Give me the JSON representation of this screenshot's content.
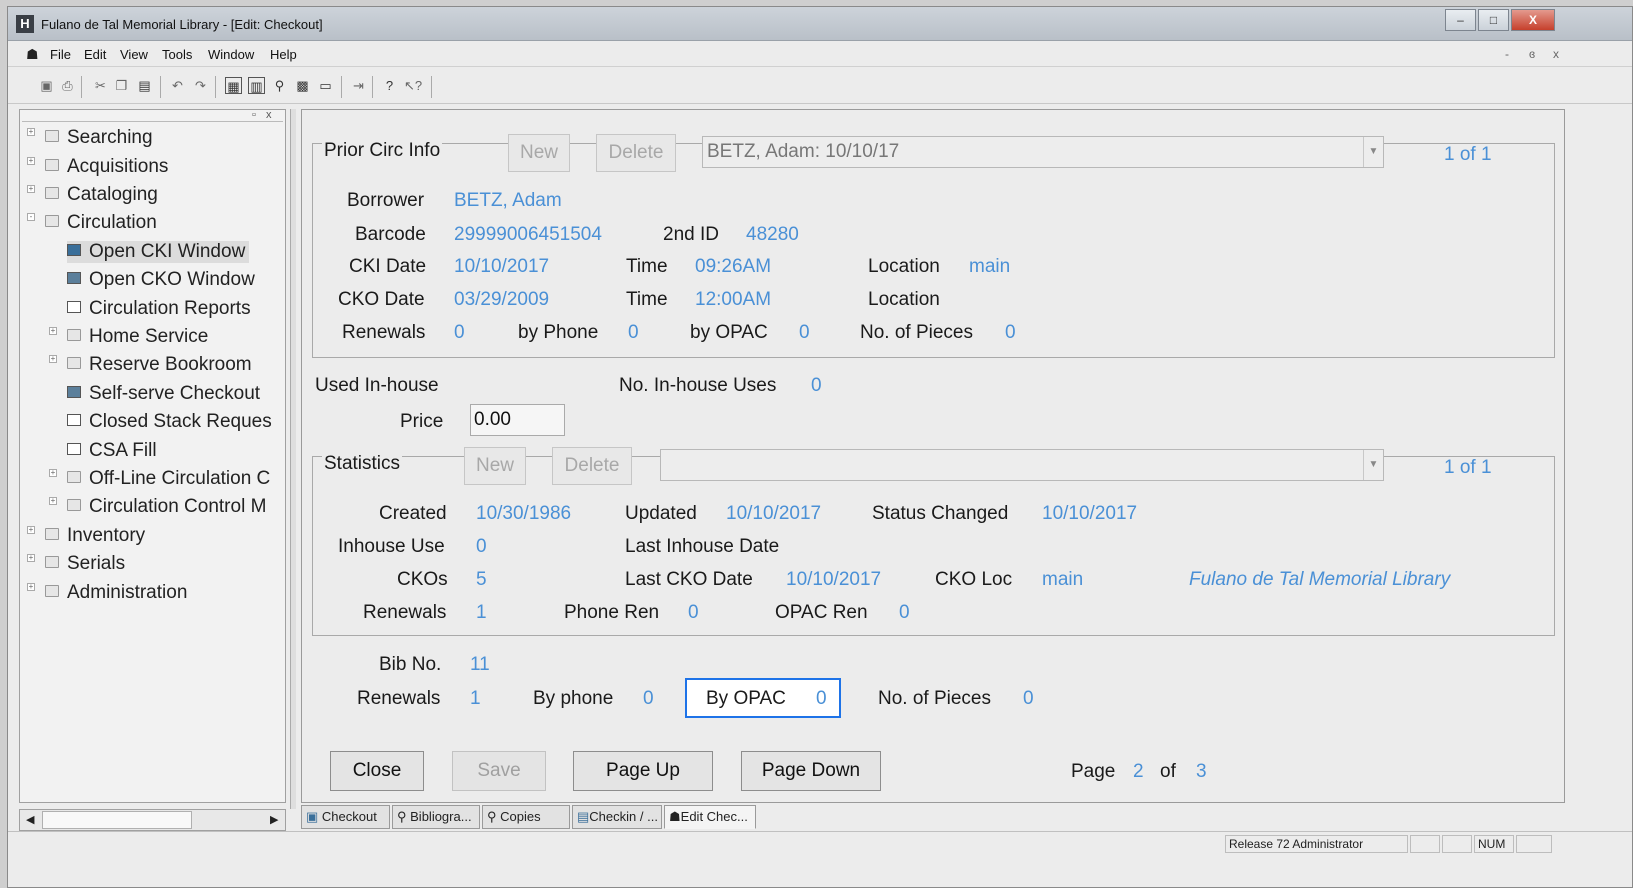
{
  "window": {
    "app_icon": "H",
    "title": "Fulano de Tal Memorial Library - [Edit: Checkout]",
    "minimize": "–",
    "maximize": "□",
    "close": "X",
    "mdi_min": "-",
    "mdi_restore": "ɞ",
    "mdi_close": "x"
  },
  "menu": [
    "File",
    "Edit",
    "View",
    "Tools",
    "Window",
    "Help"
  ],
  "toolbar_icons": [
    "save-icon",
    "print-icon",
    "cut-icon",
    "copy-icon",
    "paste-icon",
    "undo-icon",
    "redo-icon",
    "layout-icon",
    "panel-icon",
    "binoculars-icon",
    "reports-icon",
    "form-icon",
    "export-icon",
    "help-icon",
    "context-help-icon"
  ],
  "nav": {
    "items": [
      {
        "label": "Searching"
      },
      {
        "label": "Acquisitions"
      },
      {
        "label": "Cataloging"
      },
      {
        "label": "Circulation"
      },
      {
        "label": "Open CKI Window"
      },
      {
        "label": "Open CKO Window"
      },
      {
        "label": "Circulation Reports"
      },
      {
        "label": "Home Service"
      },
      {
        "label": "Reserve Bookroom"
      },
      {
        "label": "Self-serve Checkout"
      },
      {
        "label": "Closed Stack Reques"
      },
      {
        "label": "CSA Fill"
      },
      {
        "label": "Off-Line Circulation C"
      },
      {
        "label": "Circulation Control M"
      },
      {
        "label": "Inventory"
      },
      {
        "label": "Serials"
      },
      {
        "label": "Administration"
      }
    ]
  },
  "prior_circ": {
    "title": "Prior Circ Info",
    "new_label": "New",
    "delete_label": "Delete",
    "selected": "BETZ, Adam: 10/10/17",
    "count": "1 of 1",
    "borrower_label": "Borrower",
    "borrower": "BETZ, Adam",
    "barcode_label": "Barcode",
    "barcode": "29999006451504",
    "second_id_label": "2nd ID",
    "second_id": "48280",
    "cki_date_label": "CKI Date",
    "cki_date": "10/10/2017",
    "cki_time_label": "Time",
    "cki_time": "09:26AM",
    "cki_location_label": "Location",
    "cki_location": "main",
    "cko_date_label": "CKO Date",
    "cko_date": "03/29/2009",
    "cko_time_label": "Time",
    "cko_time": "12:00AM",
    "cko_location_label": "Location",
    "renewals_label": "Renewals",
    "renewals": "0",
    "by_phone_label": "by Phone",
    "by_phone": "0",
    "by_opac_label": "by OPAC",
    "by_opac": "0",
    "pieces_label": "No. of Pieces",
    "pieces": "0"
  },
  "inhouse": {
    "used_label": "Used In-house",
    "uses_label": "No. In-house Uses",
    "uses": "0",
    "price_label": "Price",
    "price": "0.00"
  },
  "statistics": {
    "title": "Statistics",
    "new_label": "New",
    "delete_label": "Delete",
    "count": "1 of 1",
    "created_label": "Created",
    "created": "10/30/1986",
    "updated_label": "Updated",
    "updated": "10/10/2017",
    "status_changed_label": "Status Changed",
    "status_changed": "10/10/2017",
    "inhouse_use_label": "Inhouse Use",
    "inhouse_use": "0",
    "last_inhouse_label": "Last Inhouse Date",
    "ckos_label": "CKOs",
    "ckos": "5",
    "last_cko_label": "Last CKO Date",
    "last_cko": "10/10/2017",
    "cko_loc_label": "CKO Loc",
    "cko_loc": "main",
    "library": "Fulano de Tal Memorial Library",
    "renewals_label": "Renewals",
    "renewals": "1",
    "phone_ren_label": "Phone Ren",
    "phone_ren": "0",
    "opac_ren_label": "OPAC Ren",
    "opac_ren": "0"
  },
  "bib": {
    "bib_no_label": "Bib No.",
    "bib_no": "11",
    "renewals_label": "Renewals",
    "renewals": "1",
    "by_phone_label": "By phone",
    "by_phone": "0",
    "by_opac_label": "By OPAC",
    "by_opac": "0",
    "pieces_label": "No. of Pieces",
    "pieces": "0"
  },
  "actions": {
    "close": "Close",
    "save": "Save",
    "page_up": "Page Up",
    "page_down": "Page Down",
    "page_label": "Page",
    "page": "2",
    "of_label": "of",
    "pages": "3"
  },
  "tabs": [
    "Checkout",
    "Bibliogra...",
    "Copies",
    "Checkin / ...",
    "Edit Chec..."
  ],
  "status": {
    "release": "Release 72 Administrator",
    "num": "NUM"
  },
  "colors": {
    "value": "#4a90d6",
    "focus": "#1e73e8"
  }
}
